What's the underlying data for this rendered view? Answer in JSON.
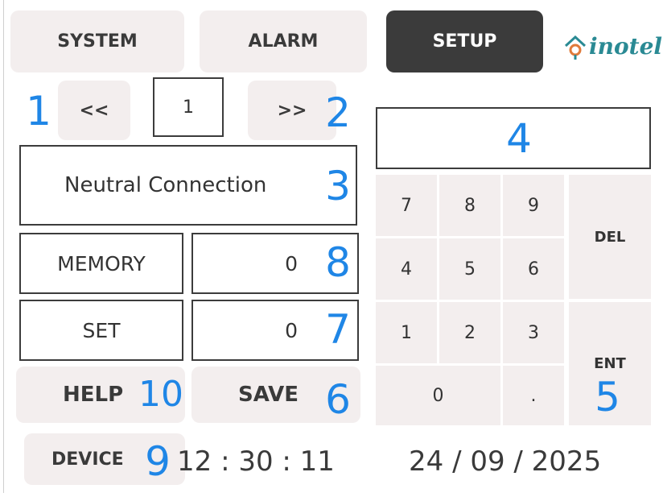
{
  "tabs": {
    "system": "SYSTEM",
    "alarm": "ALARM",
    "setup": "SETUP"
  },
  "logo": {
    "text": "inotel"
  },
  "nav": {
    "prev_label": "<<",
    "page_value": "1",
    "next_label": ">>"
  },
  "parameter": {
    "name": "Neutral Connection"
  },
  "fields": {
    "memory_label": "MEMORY",
    "memory_value": "0",
    "set_label": "SET",
    "set_value": "0"
  },
  "actions": {
    "help": "HELP",
    "save": "SAVE",
    "device": "DEVICE"
  },
  "keypad": {
    "display": "",
    "k7": "7",
    "k8": "8",
    "k9": "9",
    "k4": "4",
    "k5": "5",
    "k6": "6",
    "k1": "1",
    "k2": "2",
    "k3": "3",
    "k0": "0",
    "dot": ".",
    "del": "DEL",
    "ent": "ENT"
  },
  "status": {
    "time": "12 : 30 : 11",
    "date": "24 / 09 / 2025"
  },
  "callouts": {
    "n1": "1",
    "n2": "2",
    "n3": "3",
    "n4": "4",
    "n5": "5",
    "n6": "6",
    "n7": "7",
    "n8": "8",
    "n9": "9",
    "n10": "10"
  },
  "colors": {
    "callout": "#1f86e6",
    "button_bg": "#f3eeee",
    "active_tab_bg": "#3b3b3b",
    "logo_teal": "#2a8a94",
    "logo_orange": "#e07a3a"
  }
}
